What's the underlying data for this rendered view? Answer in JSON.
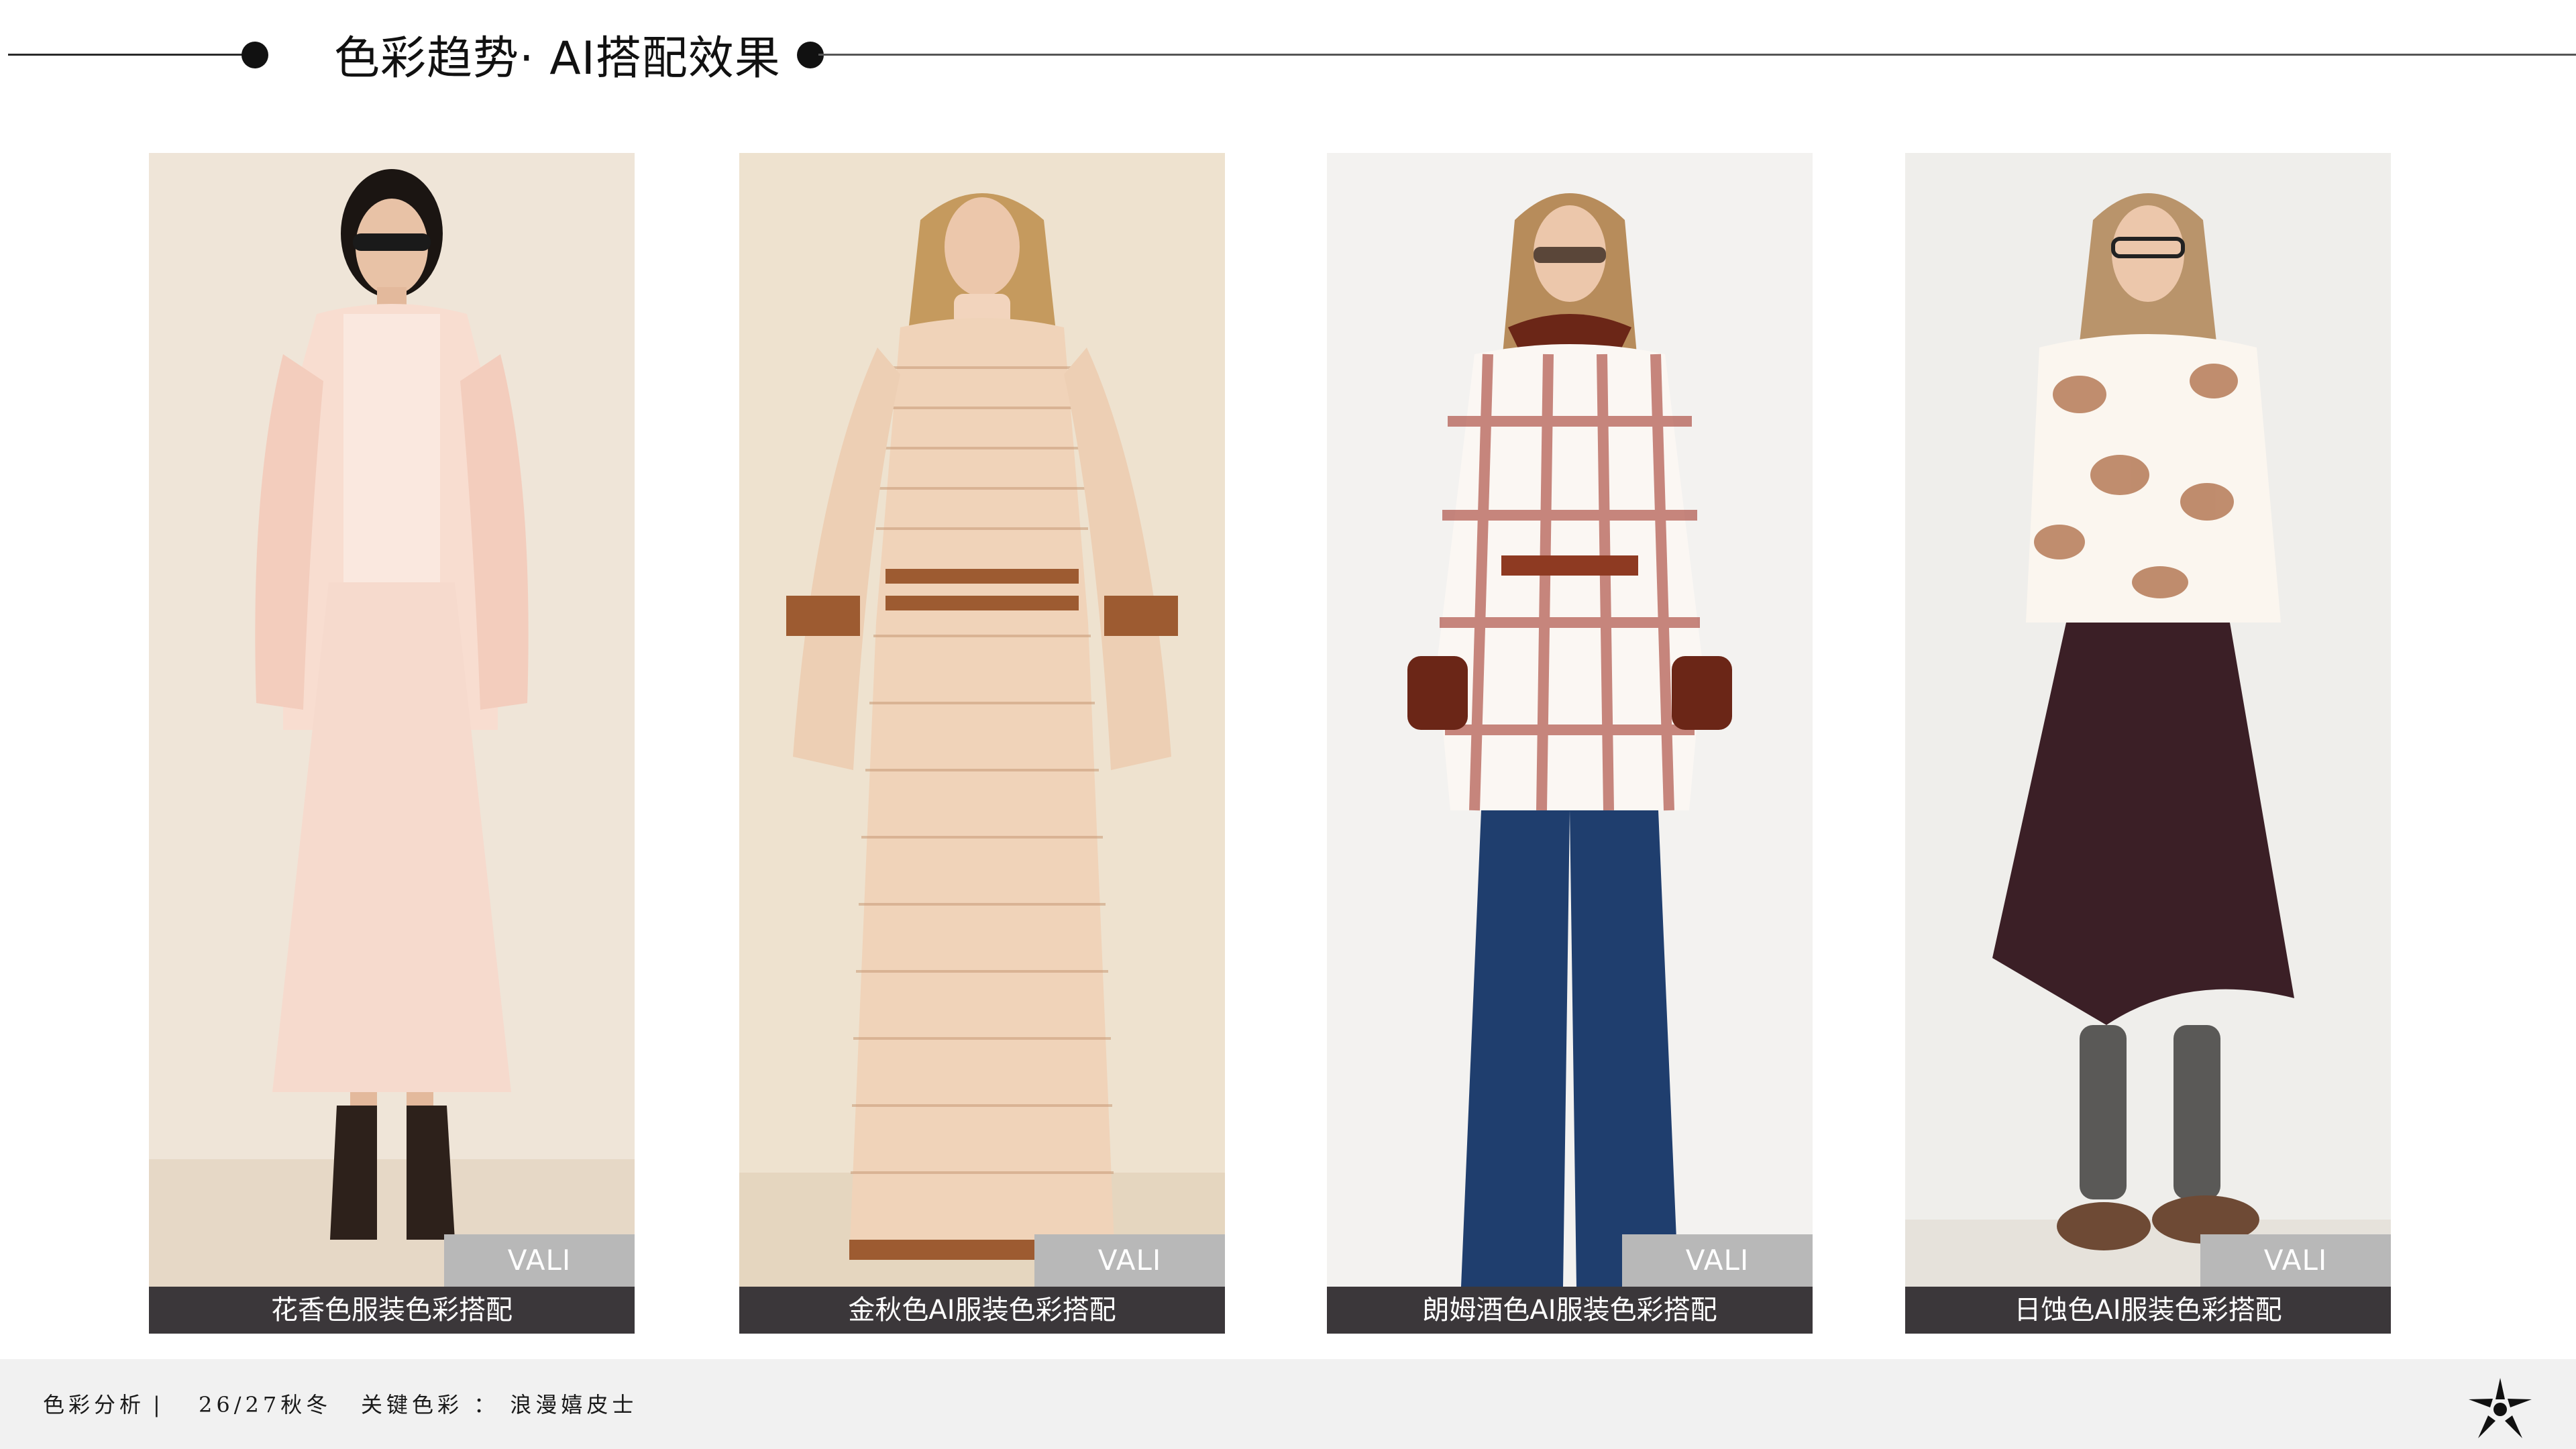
{
  "header": {
    "title": "色彩趋势· AI搭配效果"
  },
  "cards": [
    {
      "badge": "VALI",
      "caption": "花香色服装色彩搭配"
    },
    {
      "badge": "VALI",
      "caption": "金秋色AI服装色彩搭配"
    },
    {
      "badge": "VALI",
      "caption": "朗姆酒色AI服装色彩搭配"
    },
    {
      "badge": "VALI",
      "caption": "日蚀色AI服装色彩搭配"
    }
  ],
  "footer": {
    "section": "色彩分析",
    "separator": "|",
    "season": "26/27秋冬",
    "keyword": "关键色彩 ： 浪漫嬉皮士",
    "logo_icon": "starburst-logo-icon"
  },
  "colors": {
    "caption_bg": "#3b373a",
    "badge_bg": "#b8b8b8",
    "footer_bg": "#f1f1f1",
    "floral_pink": "#f6d9cc",
    "golden_autumn": "#efd3bb",
    "rum_brown": "#a24a37",
    "eclipse_plum": "#3b1f26"
  }
}
